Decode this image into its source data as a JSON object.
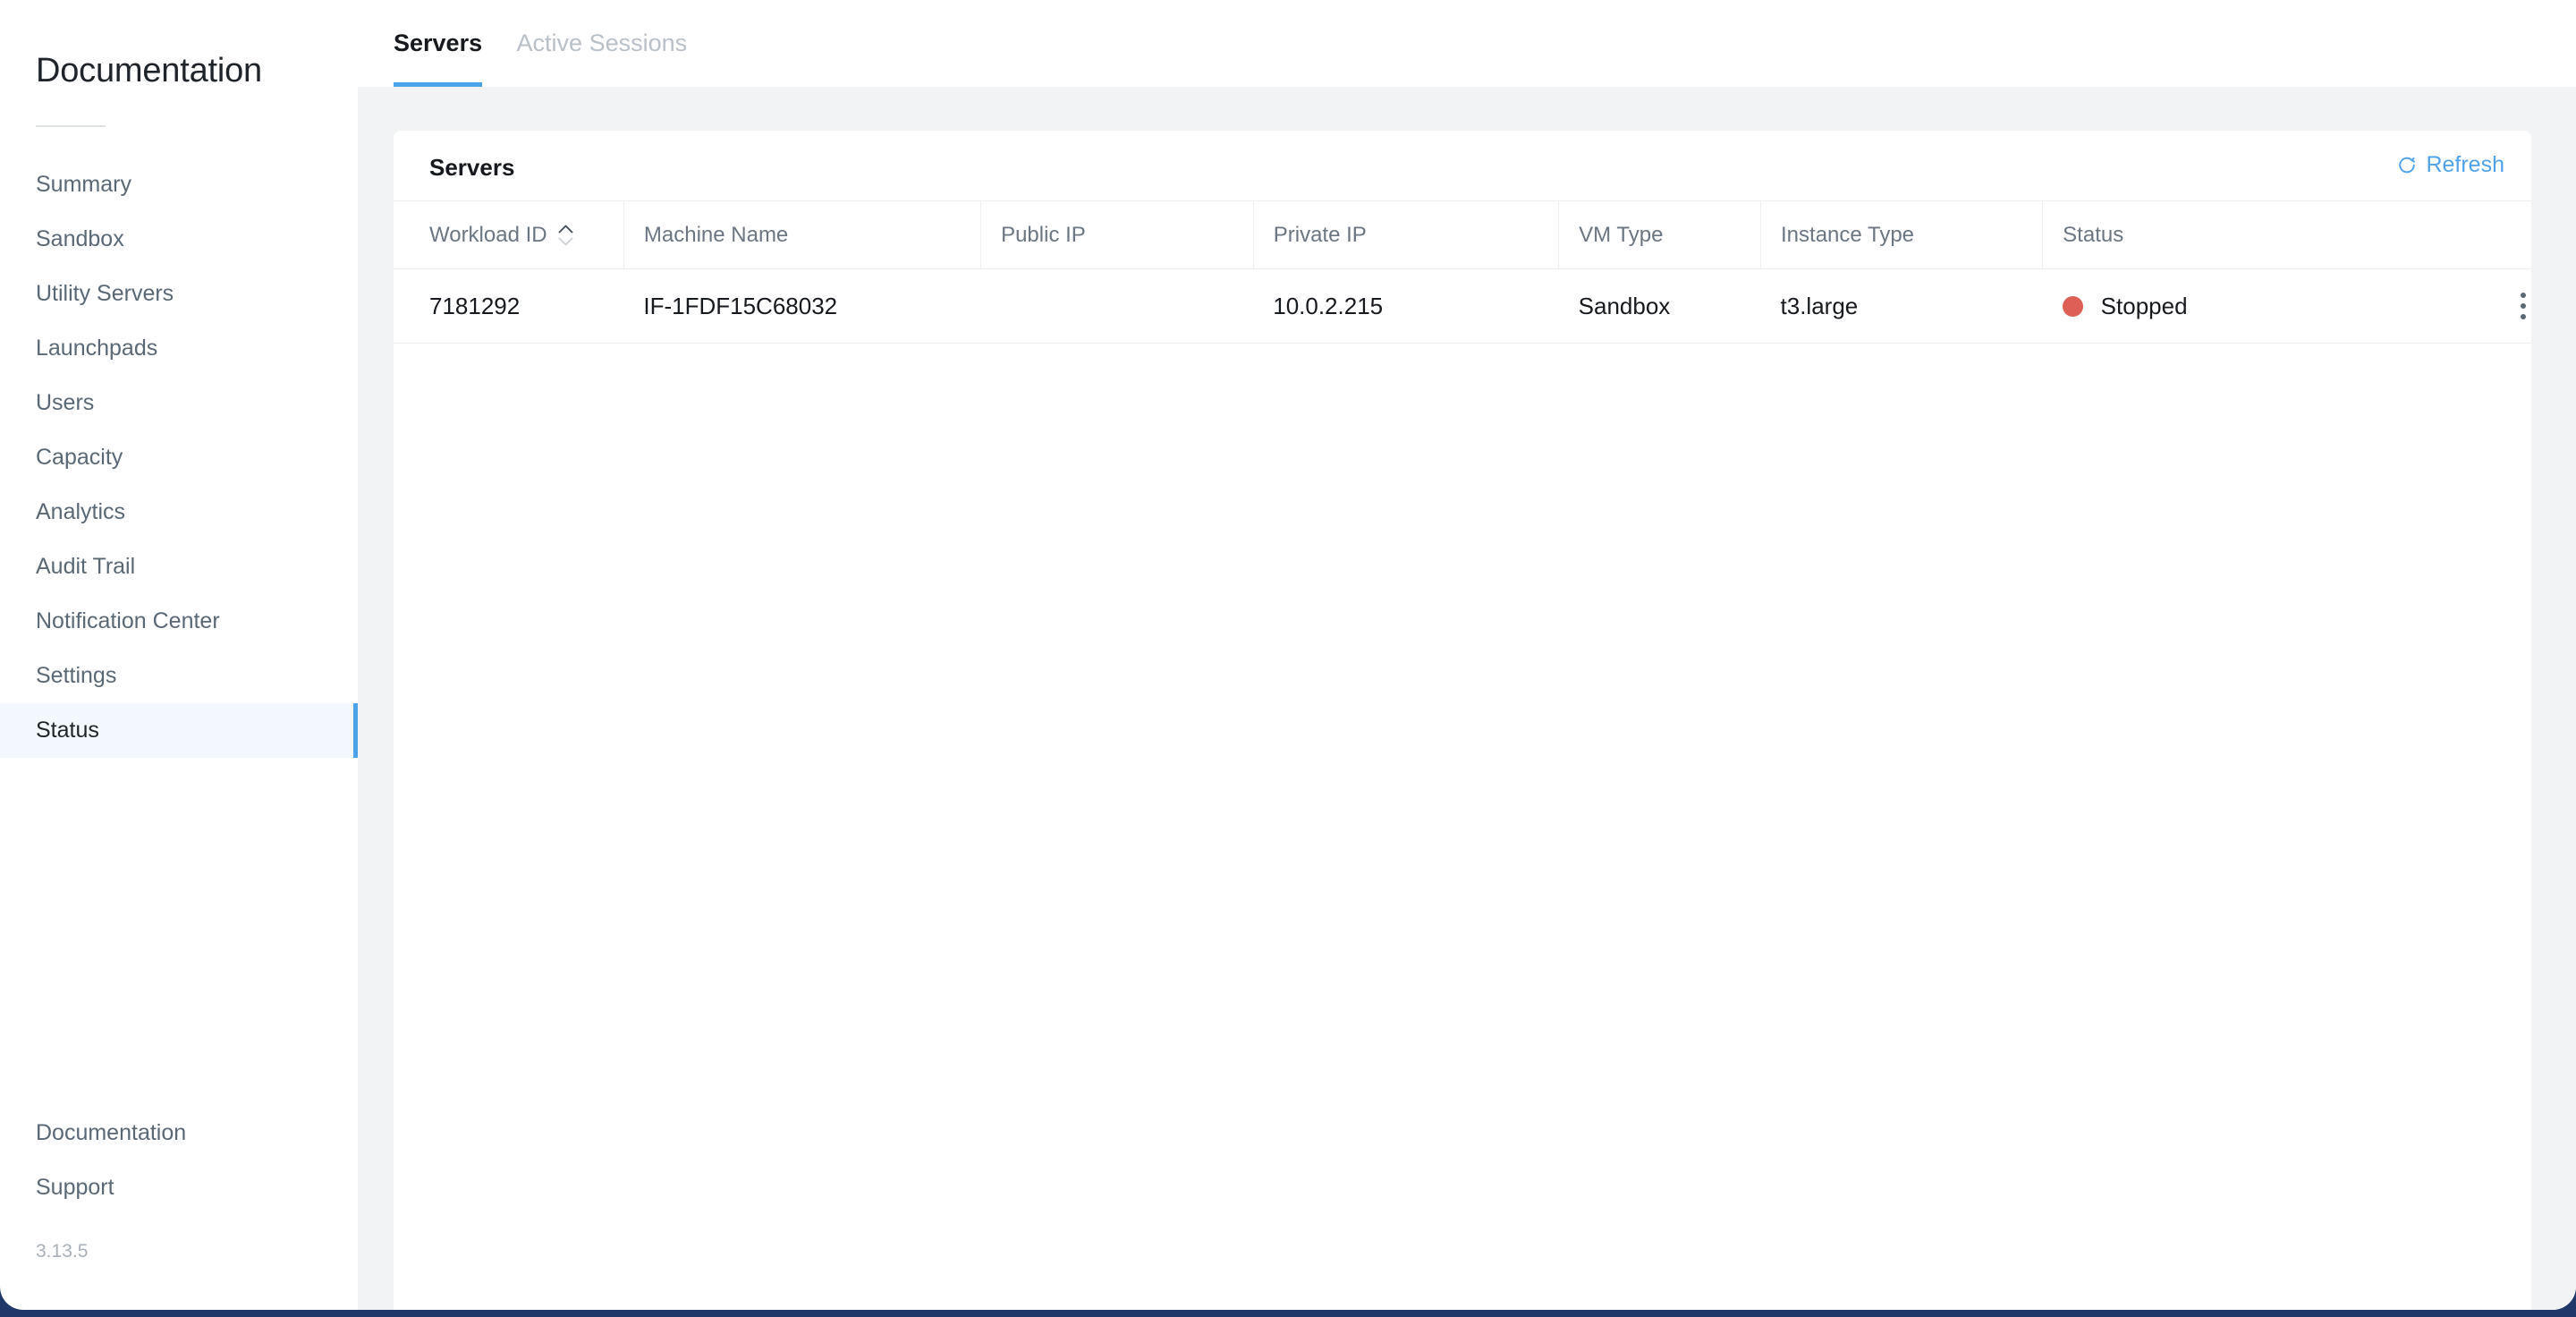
{
  "sidebar": {
    "brand": "Documentation",
    "nav_items": [
      {
        "label": "Summary",
        "active": false
      },
      {
        "label": "Sandbox",
        "active": false
      },
      {
        "label": "Utility Servers",
        "active": false
      },
      {
        "label": "Launchpads",
        "active": false
      },
      {
        "label": "Users",
        "active": false
      },
      {
        "label": "Capacity",
        "active": false
      },
      {
        "label": "Analytics",
        "active": false
      },
      {
        "label": "Audit Trail",
        "active": false
      },
      {
        "label": "Notification Center",
        "active": false
      },
      {
        "label": "Settings",
        "active": false
      },
      {
        "label": "Status",
        "active": true
      }
    ],
    "footer_items": [
      {
        "label": "Documentation"
      },
      {
        "label": "Support"
      }
    ],
    "version": "3.13.5"
  },
  "tabs": [
    {
      "label": "Servers",
      "active": true
    },
    {
      "label": "Active Sessions",
      "active": false
    }
  ],
  "card": {
    "title": "Servers",
    "refresh_label": "Refresh",
    "refresh_icon": "refresh-icon"
  },
  "table": {
    "columns": [
      {
        "label": "Workload ID",
        "sortable": true,
        "sort": "asc"
      },
      {
        "label": "Machine Name",
        "sortable": false
      },
      {
        "label": "Public IP",
        "sortable": false
      },
      {
        "label": "Private IP",
        "sortable": false
      },
      {
        "label": "VM Type",
        "sortable": false
      },
      {
        "label": "Instance Type",
        "sortable": false
      },
      {
        "label": "Status",
        "sortable": false
      }
    ],
    "rows": [
      {
        "workload_id": "7181292",
        "machine_name": "IF-1FDF15C68032",
        "public_ip": "",
        "private_ip": "10.0.2.215",
        "vm_type": "Sandbox",
        "instance_type": "t3.large",
        "status": "Stopped",
        "status_color": "#de5f55"
      }
    ]
  },
  "colors": {
    "accent": "#4ba3e8",
    "link": "#50a2e8",
    "status_stopped": "#de5f55",
    "page_background": "#f1f3f5",
    "shell": "#1f3769",
    "active_nav_background": "#f2f8fd"
  }
}
